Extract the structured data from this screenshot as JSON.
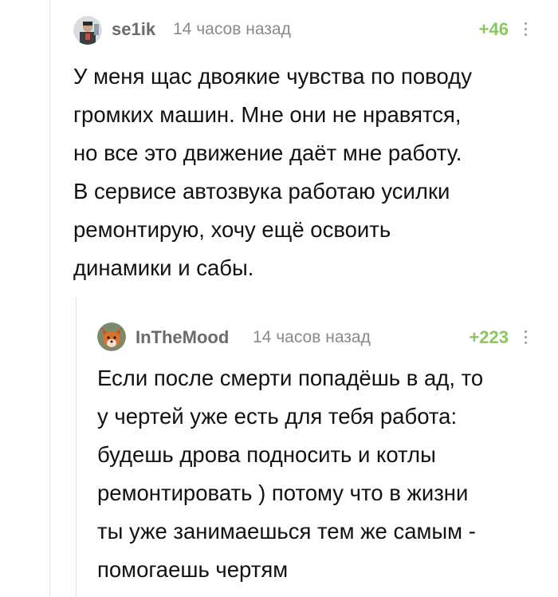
{
  "comments": [
    {
      "username": "se1ik",
      "time": "14 часов назад",
      "rating": "+46",
      "lines": [
        "У меня щас двоякие чувства по поводу",
        "громких машин. Мне они не нравятся,",
        "но все это движение даёт мне работу.",
        "В сервисе автозвука работаю усилки",
        "ремонтирую, хочу ещё освоить",
        "динамики и сабы."
      ]
    },
    {
      "username": "InTheMood",
      "time": "14 часов назад",
      "rating": "+223",
      "lines": [
        "Если после смерти попадёшь в ад, то",
        "у чертей уже есть для тебя работа:",
        "будешь дрова подносить и котлы",
        "ремонтировать ) потому что в жизни",
        "ты уже занимаешься тем же самым -",
        "помогаешь чертям"
      ]
    }
  ],
  "colors": {
    "rating_positive": "#8ac858",
    "username": "#6b6b6b",
    "timestamp": "#8a8a8a",
    "thread_line": "#e3e3e3"
  },
  "icons": {
    "more": "more-vertical-icon"
  }
}
